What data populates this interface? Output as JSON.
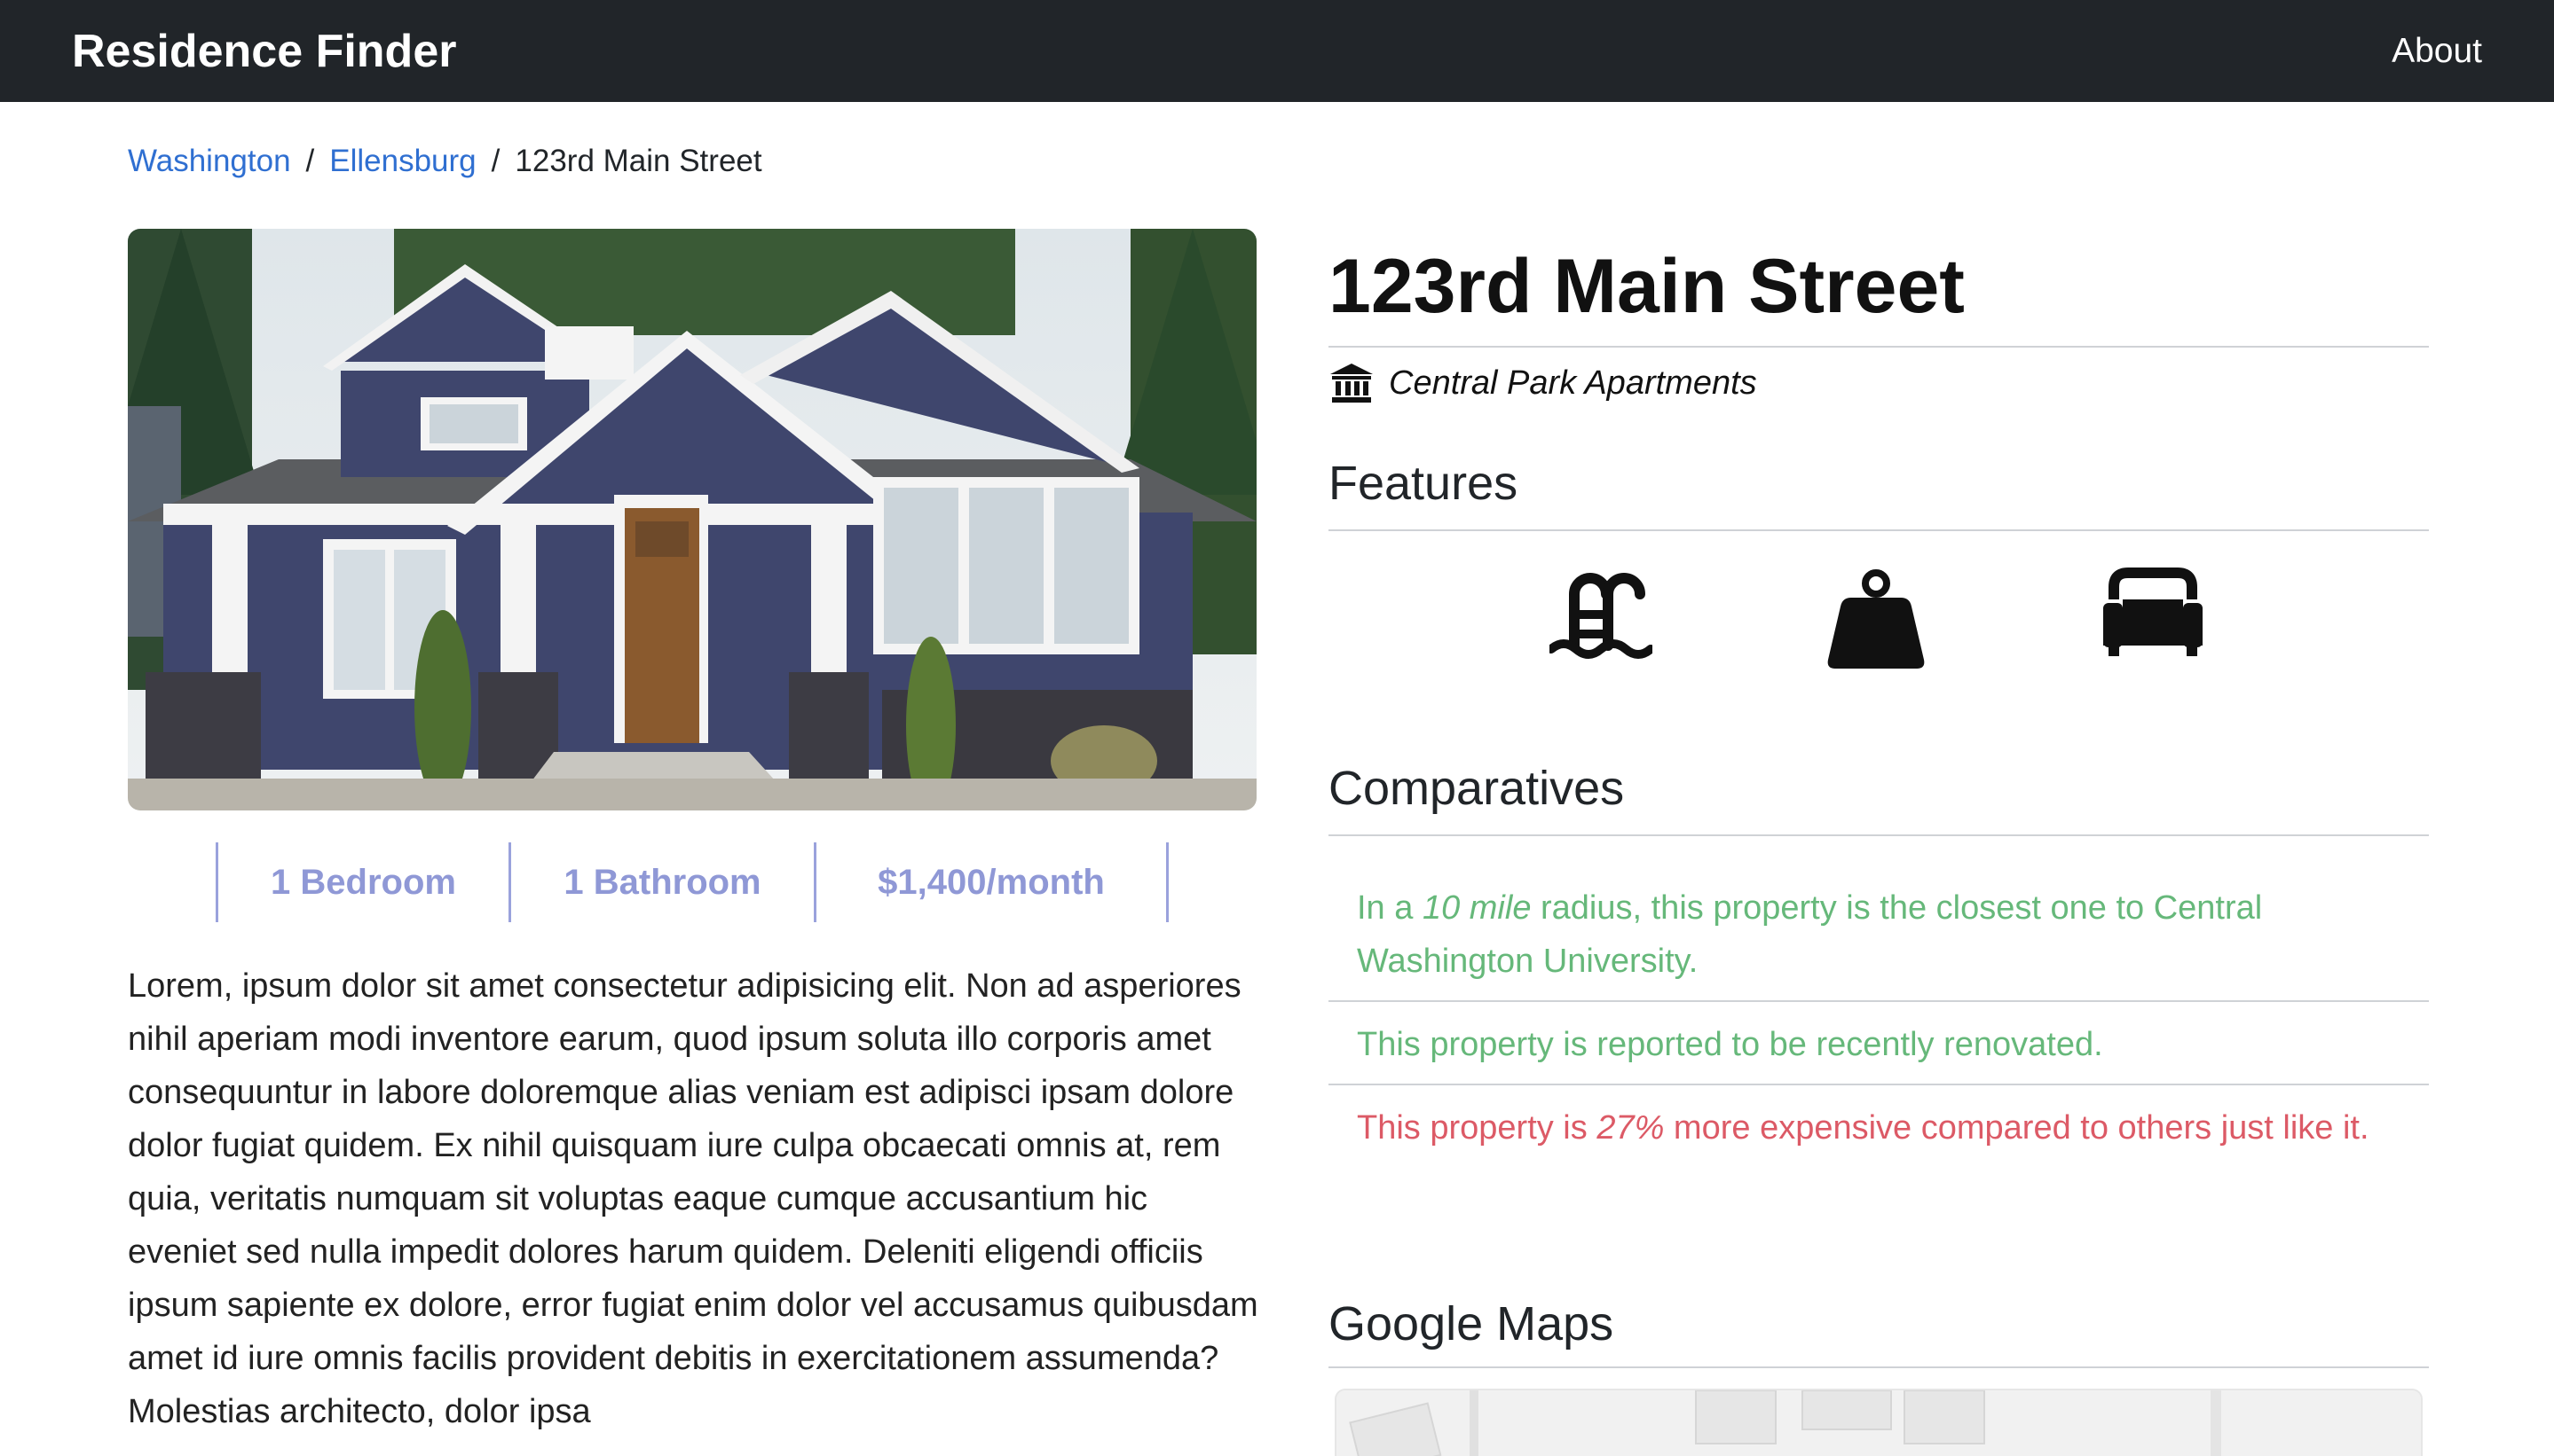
{
  "navbar": {
    "brand": "Residence Finder",
    "about": "About"
  },
  "breadcrumb": {
    "state": "Washington",
    "city": "Ellensburg",
    "current": "123rd Main Street",
    "separator": "/"
  },
  "property": {
    "photo_alt": "house-photo",
    "stats": [
      "1 Bedroom",
      "1 Bathroom",
      "$1,400/month"
    ],
    "description": "Lorem, ipsum dolor sit amet consectetur adipisicing elit. Non ad asperiores nihil aperiam modi inventore earum, quod ipsum soluta illo corporis amet consequuntur in labore doloremque alias veniam est adipisci ipsam dolore dolor fugiat quidem. Ex nihil quisquam iure culpa obcaecati omnis at, rem quia, veritatis numquam sit voluptas eaque cumque accusantium hic eveniet sed nulla impedit dolores harum quidem. Deleniti eligendi officiis ipsum sapiente ex dolore, error fugiat enim dolor vel accusamus quibusdam amet id iure omnis facilis provident debitis in exercitationem assumenda? Molestias architecto, dolor ipsa"
  },
  "details": {
    "title": "123rd Main Street",
    "complex": "Central Park Apartments",
    "complex_icon": "landmark-icon",
    "features_heading": "Features",
    "features": [
      "pool-icon",
      "weight-icon",
      "couch-icon"
    ],
    "comparatives_heading": "Comparatives",
    "comparatives": {
      "c1_pre": "In a ",
      "c1_em": "10 mile",
      "c1_post": " radius, this property is the closest one to Central Washington University.",
      "c2": "This property is reported to be recently renovated.",
      "c3_pre": "This property is ",
      "c3_em": "27%",
      "c3_post": " more expensive compared to others just like it."
    },
    "maps_heading": "Google Maps"
  },
  "colors": {
    "navbar": "#212529",
    "link": "#2f6fd1",
    "stat": "#8f98d6",
    "good": "#66b87a",
    "bad": "#dc5a66"
  }
}
